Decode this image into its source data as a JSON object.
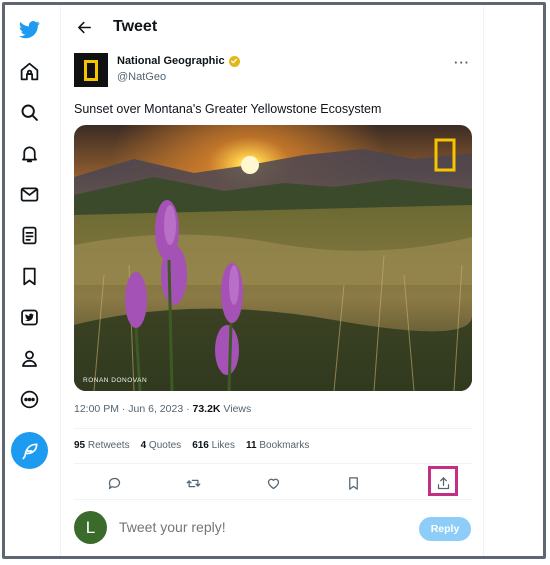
{
  "nav": {
    "items": [
      {
        "icon": "twitter-logo-icon"
      },
      {
        "icon": "home-icon"
      },
      {
        "icon": "search-icon"
      },
      {
        "icon": "notifications-bell-icon"
      },
      {
        "icon": "messages-envelope-icon"
      },
      {
        "icon": "lists-icon"
      },
      {
        "icon": "bookmarks-icon"
      },
      {
        "icon": "verified-icon"
      },
      {
        "icon": "profile-icon"
      },
      {
        "icon": "more-circle-icon"
      }
    ],
    "compose_icon": "compose-feather-icon",
    "accent": "#1d9bf0"
  },
  "header": {
    "title": "Tweet",
    "back_icon": "back-arrow-icon"
  },
  "tweet": {
    "author_name": "National Geographic",
    "handle": "@NatGeo",
    "text": "Sunset over Montana's Greater Yellowstone Ecosystem",
    "photo_credit": "RONAN DONOVAN",
    "time": "12:00 PM · Jun 6, 2023 · ",
    "views_count": "73.2K",
    "views_label": " Views",
    "stats": {
      "retweets_count": "95",
      "retweets_label": " Retweets",
      "quotes_count": "4",
      "quotes_label": " Quotes",
      "likes_count": "616",
      "likes_label": " Likes",
      "bookmarks_count": "11",
      "bookmarks_label": " Bookmarks"
    }
  },
  "actions": [
    "reply-icon",
    "retweet-icon",
    "like-icon",
    "bookmark-icon",
    "share-icon"
  ],
  "reply": {
    "avatar_letter": "L",
    "placeholder": "Tweet your reply!",
    "button_label": "Reply"
  },
  "colors": {
    "highlight": "#c42f86",
    "natgeo_yellow": "#f7c400",
    "text_secondary": "#536471"
  }
}
